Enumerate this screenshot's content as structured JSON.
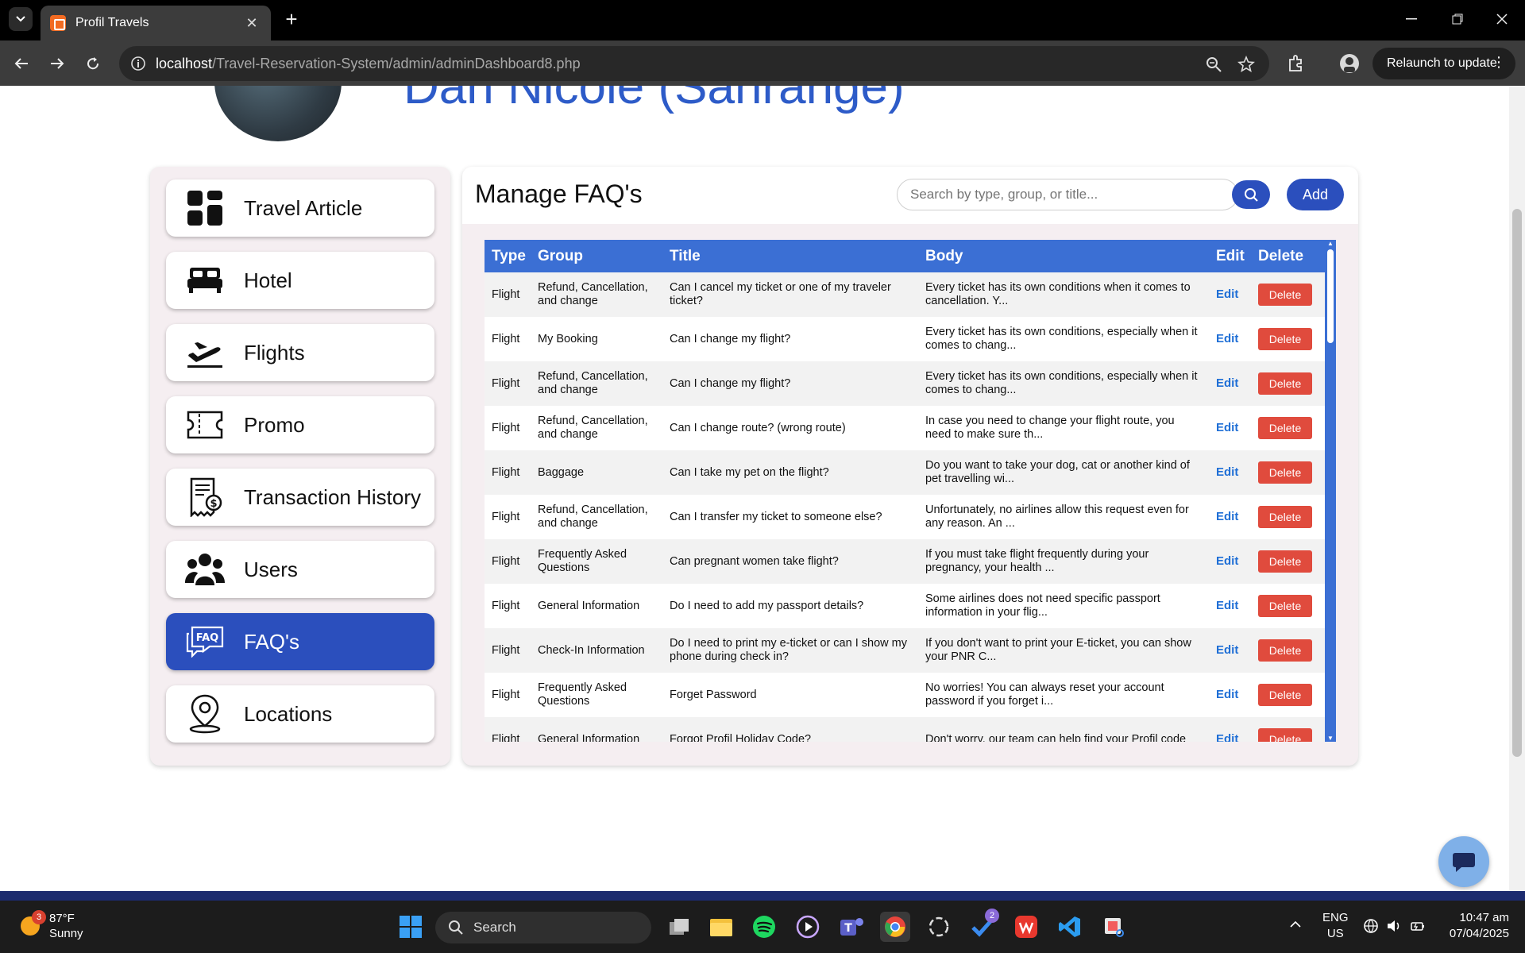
{
  "browser": {
    "tab_title": "Profil Travels",
    "url_host": "localhost",
    "url_path": "/Travel-Reservation-System/admin/adminDashboard8.php",
    "relaunch_label": "Relaunch to update"
  },
  "profile": {
    "name": "Dan Nicole (Sanrange)"
  },
  "sidebar": {
    "items": [
      {
        "label": "Travel Article",
        "icon": "dashboard-grid-icon"
      },
      {
        "label": "Hotel",
        "icon": "bed-icon"
      },
      {
        "label": "Flights",
        "icon": "plane-takeoff-icon"
      },
      {
        "label": "Promo",
        "icon": "ticket-icon"
      },
      {
        "label": "Transaction History",
        "icon": "receipt-icon"
      },
      {
        "label": "Users",
        "icon": "users-icon"
      },
      {
        "label": "FAQ's",
        "icon": "faq-icon",
        "active": true
      },
      {
        "label": "Locations",
        "icon": "location-pin-icon"
      }
    ]
  },
  "main": {
    "title": "Manage FAQ's",
    "search_placeholder": "Search by type, group, or title...",
    "add_label": "Add",
    "columns": [
      "Type",
      "Group",
      "Title",
      "Body",
      "Edit",
      "Delete"
    ],
    "edit_label": "Edit",
    "delete_label": "Delete",
    "rows": [
      {
        "type": "Flight",
        "group": "Refund, Cancellation, and change",
        "title": "Can I cancel my ticket or one of my traveler ticket?",
        "body": "Every ticket has its own conditions when it comes to cancellation. Y..."
      },
      {
        "type": "Flight",
        "group": "My Booking",
        "title": "Can I change my flight?",
        "body": "Every ticket has its own conditions, especially when it comes to chang..."
      },
      {
        "type": "Flight",
        "group": "Refund, Cancellation, and change",
        "title": "Can I change my flight?",
        "body": "Every ticket has its own conditions, especially when it comes to chang..."
      },
      {
        "type": "Flight",
        "group": "Refund, Cancellation, and change",
        "title": "Can I change route? (wrong route)",
        "body": "In case you need to change your flight route, you need to make sure th..."
      },
      {
        "type": "Flight",
        "group": "Baggage",
        "title": "Can I take my pet on the flight?",
        "body": "Do you want to take your dog, cat or another kind of pet travelling wi..."
      },
      {
        "type": "Flight",
        "group": "Refund, Cancellation, and change",
        "title": "Can I transfer my ticket to someone else?",
        "body": "Unfortunately, no airlines allow this request even for any reason. An ..."
      },
      {
        "type": "Flight",
        "group": "Frequently Asked Questions",
        "title": "Can pregnant women take flight?",
        "body": "If you must take flight frequently during your pregnancy, your health ..."
      },
      {
        "type": "Flight",
        "group": "General Information",
        "title": "Do I need to add my passport details?",
        "body": "Some airlines does not need specific passport information in your flig..."
      },
      {
        "type": "Flight",
        "group": "Check-In Information",
        "title": "Do I need to print my e-ticket or can I show my phone during check in?",
        "body": "If you don't want to print your E-ticket, you can show your PNR C..."
      },
      {
        "type": "Flight",
        "group": "Frequently Asked Questions",
        "title": "Forget Password",
        "body": "No worries! You can always reset your account password if you forget i..."
      },
      {
        "type": "Flight",
        "group": "General Information",
        "title": "Forgot Profil Holiday Code?",
        "body": "Don't worry, our team can help find your Profil code"
      }
    ]
  },
  "taskbar": {
    "weather_temp": "87°F",
    "weather_desc": "Sunny",
    "weather_badge": "3",
    "search_label": "Search",
    "todo_badge": "2",
    "lang_top": "ENG",
    "lang_bottom": "US",
    "time": "10:47 am",
    "date": "07/04/2025"
  },
  "colors": {
    "brand_blue": "#2b4fbd",
    "table_header": "#3b6fd4",
    "delete_red": "#e04b3d",
    "edit_link": "#1f6fd6"
  }
}
